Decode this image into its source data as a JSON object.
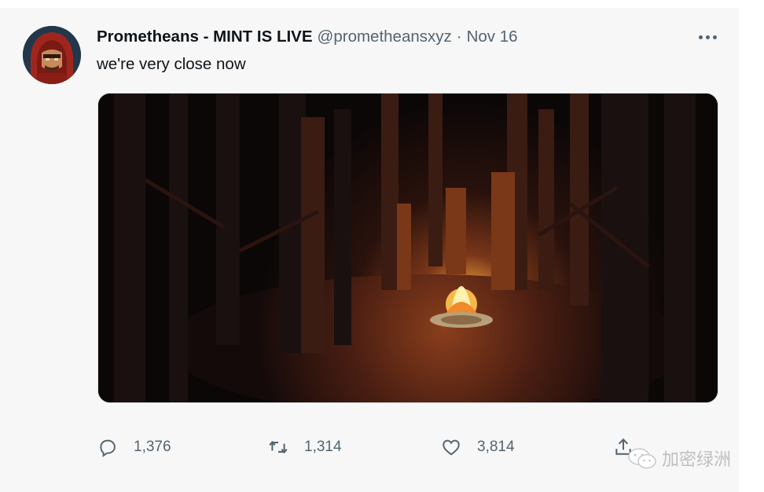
{
  "tweet": {
    "display_name": "Prometheans - MINT IS LIVE",
    "handle": "@prometheansxyz",
    "separator": "·",
    "date": "Nov 16",
    "text": "we're very close now",
    "more_icon": "more-horizontal-icon",
    "avatar_icon": "hooded-figure-avatar"
  },
  "media": {
    "description_icon": "pixel-art-forest-campfire-image"
  },
  "actions": {
    "reply_count": "1,376",
    "retweet_count": "1,314",
    "like_count": "3,814",
    "reply_icon": "reply-bubble-icon",
    "retweet_icon": "retweet-icon",
    "like_icon": "heart-icon",
    "share_icon": "share-upload-icon"
  },
  "watermark": {
    "text": "加密绿洲",
    "icon": "wechat-icon"
  },
  "colors": {
    "text_primary": "#0f1419",
    "text_secondary": "#536471",
    "card_bg": "#f7f7f7"
  }
}
